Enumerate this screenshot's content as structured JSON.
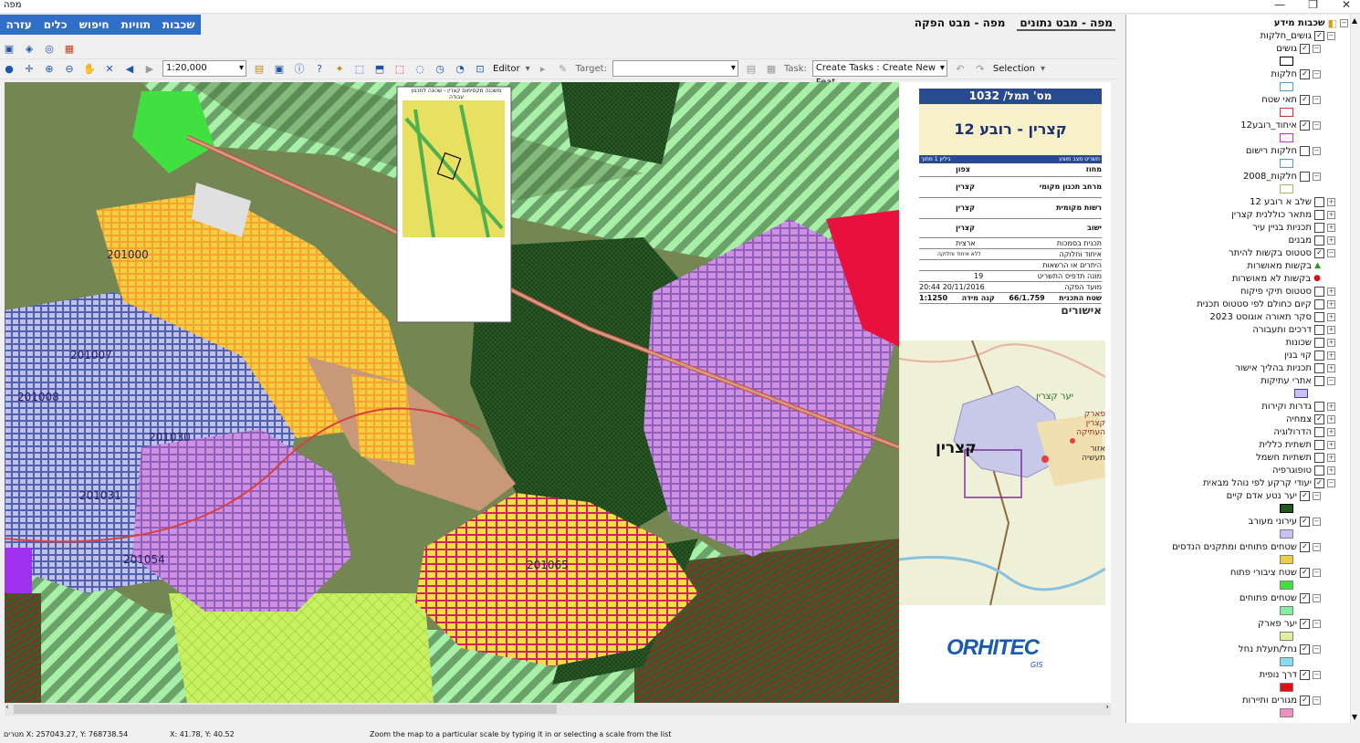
{
  "window": {
    "title": "מפה",
    "minimize": "—",
    "restore": "❐",
    "close": "✕"
  },
  "menu": [
    "שכבות",
    "תוויות",
    "חיפוש",
    "כלים",
    "עזרה"
  ],
  "tabs": [
    "מפה - מבט נתונים",
    "מפה - מבט הפקה"
  ],
  "toolbar": {
    "scale": "1:20,000",
    "editor": "Editor",
    "target_label": "Target:",
    "task_label": "Task:",
    "task_value": "Create Tasks : Create New Feat",
    "selection": "Selection"
  },
  "statusbar": {
    "coords": "מטרים X: 257043.27, Y: 768738.54",
    "page_coords": "X: 41.78, Y: 40.52",
    "hint": "Zoom the map to a particular scale by typing it in or selecting a scale from the list"
  },
  "map": {
    "labels": [
      "201000",
      "201007",
      "201008",
      "201030",
      "201031",
      "201054",
      "201065"
    ],
    "inset_title": "משכנה מקסימום קצרין - שכונה לתכנון עבודה"
  },
  "plan_card": {
    "header": "מס' תמל/ 1032",
    "title": "קצרין - רובע 12",
    "subheader_right": "תשריט מצב מוצע",
    "subheader_left": "גיליון 1 מתוך",
    "rows": [
      {
        "label": "מחוז",
        "value": "צפון"
      },
      {
        "label": "מרחב תכנון מקומי",
        "value": "קצרין"
      },
      {
        "label": "רשות מקומית",
        "value": "קצרין"
      },
      {
        "label": "ישוב",
        "value": "קצרין"
      },
      {
        "label": "תכנית בסמכות",
        "value": "ארצית"
      },
      {
        "label": "איחוד וחלוקה",
        "value": "ללא איחוד וחלוקה"
      },
      {
        "label": "היתרים או הרשאות",
        "value": ""
      },
      {
        "label": "מונה תדפיס התשריט",
        "value": "19"
      },
      {
        "label": "מועד הפקה",
        "value": "20/11/2016 20:44"
      },
      {
        "label": "שטח התכנית",
        "value": "66/1.759"
      },
      {
        "label": "קנה מידה",
        "value": "1:1250"
      }
    ],
    "approvals": "אישורים"
  },
  "locator": {
    "town": "קצרין",
    "labels": [
      "יער קצרין",
      "פארק קצרין העתיקה",
      "אזור תעשיה"
    ]
  },
  "logo": {
    "text": "ORHITEC",
    "sub": "GIS"
  },
  "toc": {
    "root": "שכבות מידע",
    "items": [
      {
        "label": "גושים_חלקות",
        "level": 1,
        "checked": true,
        "expanded": true
      },
      {
        "label": "גושים",
        "level": 2,
        "checked": true,
        "expanded": true,
        "swatch": {
          "fill": "#ffffff",
          "border": "#000000"
        }
      },
      {
        "label": "חלקות",
        "level": 2,
        "checked": true,
        "expanded": true,
        "swatch": {
          "fill": "#ffffff",
          "border": "#4aa0e0"
        }
      },
      {
        "label": "תאי שטח",
        "level": 2,
        "checked": true,
        "expanded": true,
        "swatch": {
          "fill": "#ffffff",
          "border": "#d83030"
        }
      },
      {
        "label": "איחוד_רובע12",
        "level": 2,
        "checked": true,
        "expanded": true,
        "swatch": {
          "fill": "#ffffff",
          "border": "#e020e0"
        }
      },
      {
        "label": "חלקות רישום",
        "level": 2,
        "checked": false,
        "expanded": true,
        "swatch": {
          "fill": "#ffffff",
          "border": "#4aa0e0"
        }
      },
      {
        "label": "חלקות_2008",
        "level": 2,
        "checked": false,
        "expanded": true,
        "swatch": {
          "fill": "#ffffff",
          "border": "#9cc060"
        }
      },
      {
        "label": "שלב א רובע 12",
        "level": 1,
        "checked": false,
        "expanded": false
      },
      {
        "label": "מתאר כוללנית קצרין",
        "level": 1,
        "checked": false,
        "expanded": false
      },
      {
        "label": "תכניות בניין עיר",
        "level": 1,
        "checked": false,
        "expanded": false
      },
      {
        "label": "מבנים",
        "level": 1,
        "checked": false,
        "expanded": false
      },
      {
        "label": "סטטוס בקשות להיתר",
        "level": 1,
        "checked": true,
        "expanded": true
      },
      {
        "label": "בקשות מאושרות",
        "level": 2,
        "marker": "▲",
        "marker_color": "#2a9a2a"
      },
      {
        "label": "בקשות לא מאושרות",
        "level": 2,
        "marker": "●",
        "marker_color": "#d81010"
      },
      {
        "label": "סטטוס תיקי פיקוח",
        "level": 1,
        "checked": false,
        "expanded": false
      },
      {
        "label": "קיום כחולם לפי סטטוס תכנית",
        "level": 1,
        "checked": false,
        "expanded": false
      },
      {
        "label": "סקר תאורה אוגוסט 2023",
        "level": 1,
        "checked": false,
        "expanded": false
      },
      {
        "label": "דרכים ותעבורה",
        "level": 1,
        "checked": false,
        "expanded": false
      },
      {
        "label": "שכונות",
        "level": 1,
        "checked": false,
        "expanded": false
      },
      {
        "label": "קוי בנין",
        "level": 1,
        "checked": false,
        "expanded": false
      },
      {
        "label": "תכניות בהליך אישור",
        "level": 1,
        "checked": false,
        "expanded": false
      },
      {
        "label": "אתרי עתיקות",
        "level": 1,
        "checked": false,
        "expanded": true,
        "swatch": {
          "fill": "#c8c0f0",
          "border": "#4040a0"
        }
      },
      {
        "label": "גדרות וקירות",
        "level": 1,
        "checked": false,
        "expanded": false
      },
      {
        "label": "צמחיה",
        "level": 1,
        "checked": true,
        "expanded": false
      },
      {
        "label": "הדרולוגיה",
        "level": 1,
        "checked": false,
        "expanded": false
      },
      {
        "label": "תשתית כללית",
        "level": 1,
        "checked": false,
        "expanded": false
      },
      {
        "label": "תשתיות חשמל",
        "level": 1,
        "checked": false,
        "expanded": false
      },
      {
        "label": "טופוגרפיה",
        "level": 1,
        "checked": false,
        "expanded": false
      },
      {
        "label": "יעודי קרקע לפי נוהל מבאית",
        "level": 1,
        "checked": true,
        "expanded": true
      },
      {
        "label": "יער נטע אדם קיים",
        "level": 2,
        "checked": true,
        "expanded": true,
        "swatch": {
          "fill": "#1e5a1e",
          "border": "#000000"
        }
      },
      {
        "label": "עירוני מעורב",
        "level": 2,
        "checked": true,
        "expanded": true,
        "swatch": {
          "fill": "#c8c0f0",
          "border": "#808080"
        }
      },
      {
        "label": "שטחים פתוחים ומתקנים הנדסים",
        "level": 2,
        "checked": true,
        "expanded": true,
        "swatch": {
          "fill": "#e8d040",
          "border": "#808080"
        }
      },
      {
        "label": "שטח ציבורי פתוח",
        "level": 2,
        "checked": true,
        "expanded": true,
        "swatch": {
          "fill": "#40e040",
          "border": "#808080"
        }
      },
      {
        "label": "שטחים פתוחים",
        "level": 2,
        "checked": true,
        "expanded": true,
        "swatch": {
          "fill": "#80f0a0",
          "border": "#808080"
        }
      },
      {
        "label": "יער פארק",
        "level": 2,
        "checked": true,
        "expanded": true,
        "swatch": {
          "fill": "#e0f0a0",
          "border": "#808080"
        }
      },
      {
        "label": "נחל/תעלת נחל",
        "level": 2,
        "checked": true,
        "expanded": true,
        "swatch": {
          "fill": "#80e0f0",
          "border": "#808080"
        }
      },
      {
        "label": "דרך נופית",
        "level": 2,
        "checked": true,
        "expanded": true,
        "swatch": {
          "fill": "#e01010",
          "border": "#808080"
        }
      },
      {
        "label": "מגורים ותיירות",
        "level": 2,
        "checked": true,
        "expanded": true,
        "swatch": {
          "fill": "#f090c0",
          "border": "#808080"
        }
      }
    ]
  }
}
